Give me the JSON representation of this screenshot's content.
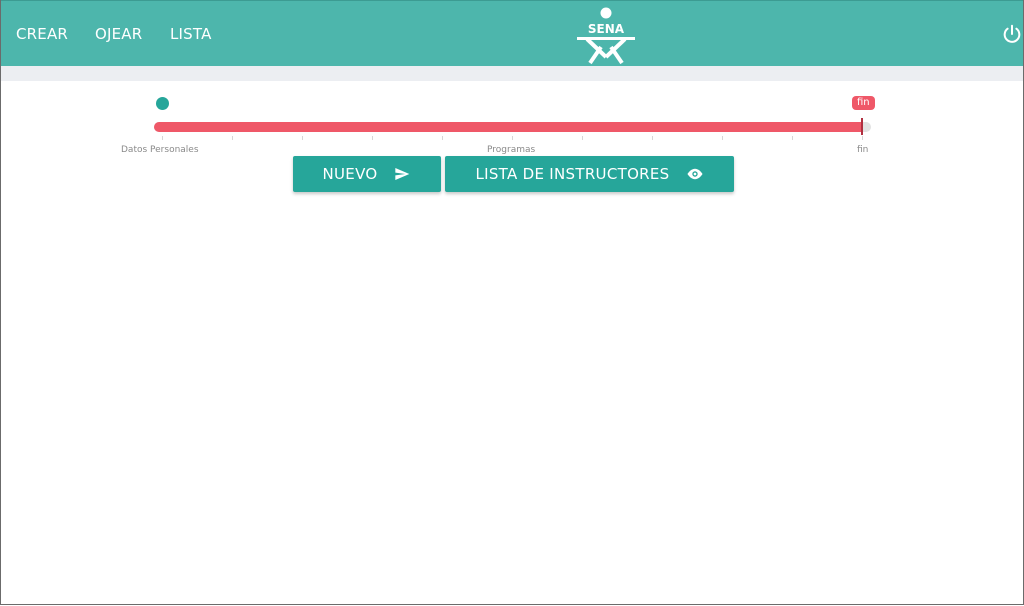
{
  "nav": {
    "items": [
      {
        "label": "CREAR"
      },
      {
        "label": "OJEAR"
      },
      {
        "label": "LISTA"
      }
    ],
    "logo_text": "SENA",
    "logout_icon": "power-icon"
  },
  "colors": {
    "header": "#4db6ac",
    "accent": "#26a69a",
    "progress": "#ef5868",
    "subbar": "#eceef2"
  },
  "progress": {
    "value_fraction": 0.99,
    "pin_label": "fin",
    "tick_labels": [
      "Datos Personales",
      "Programas",
      "fin"
    ]
  },
  "buttons": {
    "nuevo": {
      "label": "NUEVO",
      "icon": "send-icon"
    },
    "lista": {
      "label": "LISTA DE INSTRUCTORES",
      "icon": "eye-icon"
    }
  }
}
